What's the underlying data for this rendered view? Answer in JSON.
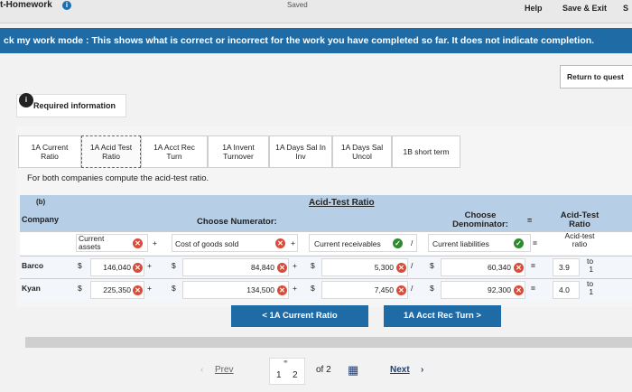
{
  "topbar": {
    "app_title": "t-Homework",
    "info_badge": "i",
    "saved": "Saved",
    "help": "Help",
    "save_exit": "Save & Exit",
    "submit": "S"
  },
  "banner": {
    "text": "ck my work mode : This shows what is correct or incorrect for the work you have completed so far. It does not indicate completion."
  },
  "return_button": "Return to quest",
  "required": {
    "badge": "i",
    "label": "Required information"
  },
  "tabs": [
    {
      "line1": "1A Current",
      "line2": "Ratio"
    },
    {
      "line1": "1A Acid Test",
      "line2": "Ratio"
    },
    {
      "line1": "1A Acct Rec",
      "line2": "Turn"
    },
    {
      "line1": "1A Invent",
      "line2": "Turnover"
    },
    {
      "line1": "1A Days Sal In",
      "line2": "Inv"
    },
    {
      "line1": "1A Days Sal",
      "line2": "Uncol"
    },
    {
      "line1": "1B short term",
      "line2": ""
    }
  ],
  "question": "For both companies compute the acid-test ratio.",
  "table": {
    "part": "(b)",
    "title": "Acid-Test Ratio",
    "company_header": "Company",
    "numerator_header": "Choose Numerator:",
    "denominator_header_1": "Choose",
    "denominator_header_2": "Denominator:",
    "equals": "=",
    "result_header_1": "Acid-Test",
    "result_header_2": "Ratio",
    "labels_row": {
      "item1_1": "Current",
      "item1_2": "assets",
      "item2": "Cost of goods sold",
      "item3": "Current receivables",
      "denominator": "Current liabilities",
      "result_1": "Acid-test",
      "result_2": "ratio",
      "plus": "+",
      "slash": "/",
      "eq": "="
    },
    "rows": [
      {
        "company": "Barco",
        "d1": "$",
        "v1": "146,040",
        "d2": "$",
        "v2": "84,840",
        "d3": "$",
        "v3": "5,300",
        "d4": "$",
        "v4": "60,340",
        "ratio": "3.9",
        "suffix_1": "to",
        "suffix_2": "1"
      },
      {
        "company": "Kyan",
        "d1": "$",
        "v1": "225,350",
        "d2": "$",
        "v2": "134,500",
        "d3": "$",
        "v3": "7,450",
        "d4": "$",
        "v4": "92,300",
        "ratio": "4.0",
        "suffix_1": "to",
        "suffix_2": "1"
      }
    ]
  },
  "nav_prev": "< 1A Current Ratio",
  "nav_next": "1A Acct Rec Turn >",
  "pager": {
    "prev": "Prev",
    "page_current": "1",
    "page_2": "2",
    "of": "of 2",
    "next": "Next"
  },
  "colors": {
    "banner": "#1f6ba6",
    "header_fill": "#b7cfe6",
    "error": "#d94c3a",
    "correct": "#2f8a2f"
  }
}
